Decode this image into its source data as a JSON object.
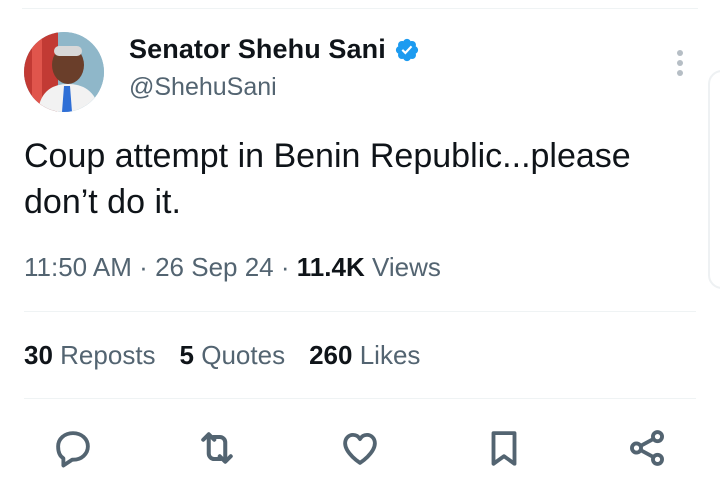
{
  "author": {
    "display_name": "Senator Shehu Sani",
    "handle": "@ShehuSani",
    "verified_icon": "verified-badge-icon",
    "avatar_icon": "avatar"
  },
  "tweet": {
    "text_line1": "Coup attempt in Benin Republic...please",
    "text_line2": "don’t do it."
  },
  "meta": {
    "time": "11:50 AM",
    "sep1": "·",
    "date": "26 Sep 24",
    "sep2": "·",
    "views_count": "11.4K",
    "views_label": "Views"
  },
  "stats": {
    "reposts_count": "30",
    "reposts_label": "Reposts",
    "quotes_count": "5",
    "quotes_label": "Quotes",
    "likes_count": "260",
    "likes_label": "Likes"
  },
  "actions": [
    "reply-icon",
    "repost-icon",
    "like-icon",
    "bookmark-icon",
    "share-icon"
  ],
  "colors": {
    "text": "#0f1419",
    "muted": "#536471",
    "verified": "#1d9bf0",
    "divider": "#eff3f4"
  }
}
